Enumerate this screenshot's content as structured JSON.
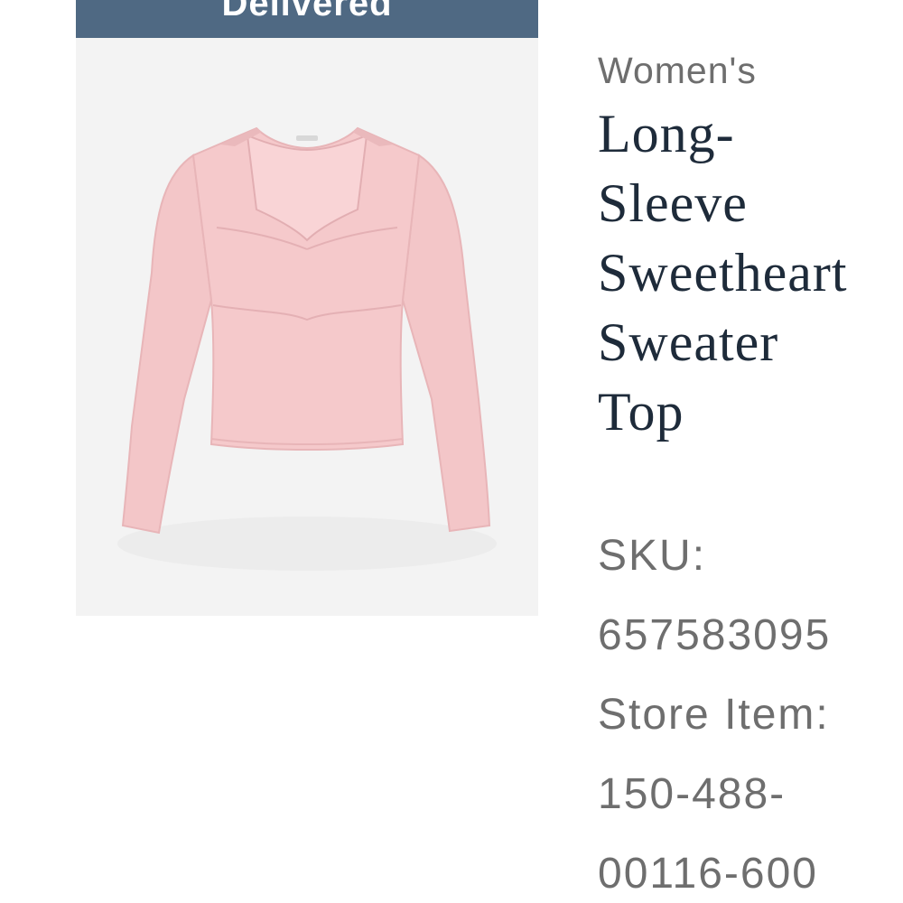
{
  "status_banner": {
    "label": "Delivered",
    "color": "#4f6983"
  },
  "product": {
    "image_icon": "pink-sweater-image",
    "garment_color": "#f2c4c6",
    "gender": "Women's",
    "title_lines": [
      "Long-",
      "Sleeve",
      "Sweetheart",
      "Sweater",
      "Top"
    ],
    "sku_label": "SKU:",
    "sku_value": "657583095",
    "store_item_label": "Store Item:",
    "store_item_value_lines": [
      "150-488-",
      "00116-600"
    ]
  }
}
